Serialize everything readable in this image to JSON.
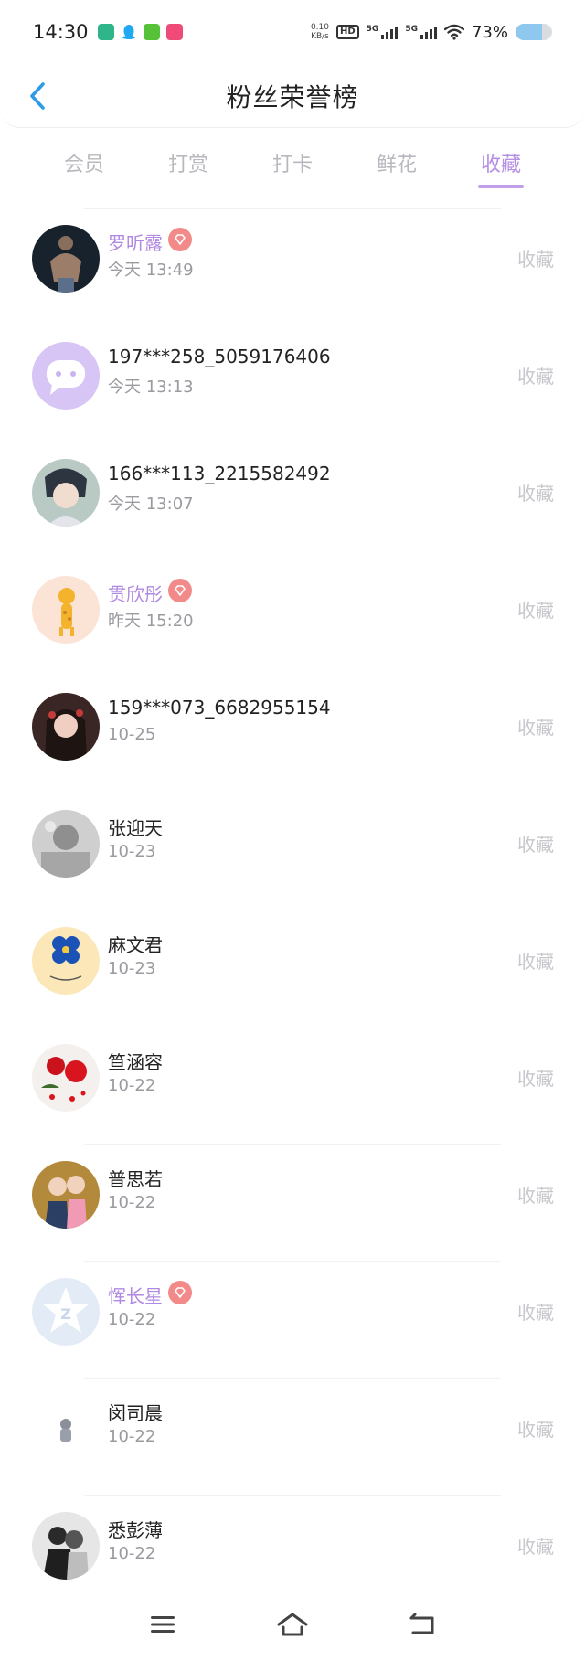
{
  "status_bar": {
    "time": "14:30",
    "net_speed_value": "0.10",
    "net_speed_unit": "KB/s",
    "hd_label": "HD",
    "sim1_label": "5G",
    "sim2_label": "5G",
    "battery_percent_text": "73%",
    "battery_level": 0.73,
    "app_icons": [
      "aggregator-app-icon",
      "qq-icon",
      "wechat-icon",
      "shop-app-icon"
    ]
  },
  "header": {
    "title": "粉丝荣誉榜",
    "back_icon": "chevron-left-icon"
  },
  "tabs": [
    {
      "label": "会员",
      "active": false
    },
    {
      "label": "打赏",
      "active": false
    },
    {
      "label": "打卡",
      "active": false
    },
    {
      "label": "鲜花",
      "active": false
    },
    {
      "label": "收藏",
      "active": true
    }
  ],
  "colors": {
    "accent": "#b590e6",
    "vip_name": "#b08ae2",
    "vip_badge": "#f28a8a",
    "back_arrow": "#2f9be8"
  },
  "fans": [
    {
      "name": "罗听露",
      "time": "今天 13:49",
      "vip": true,
      "action": "收藏",
      "avatar": "muscular-man-photo"
    },
    {
      "name": "197***258_5059176406",
      "time": "今天 13:13",
      "vip": false,
      "action": "收藏",
      "avatar": "default-chat-avatar"
    },
    {
      "name": "166***113_2215582492",
      "time": "今天 13:07",
      "vip": false,
      "action": "收藏",
      "avatar": "anime-boy-photo"
    },
    {
      "name": "贯欣彤",
      "time": "昨天 15:20",
      "vip": true,
      "action": "收藏",
      "avatar": "cartoon-deer-photo"
    },
    {
      "name": "159***073_6682955154",
      "time": "10-25",
      "vip": false,
      "action": "收藏",
      "avatar": "girl-portrait-photo"
    },
    {
      "name": "张迎天",
      "time": "10-23",
      "vip": false,
      "action": "收藏",
      "avatar": "grayscale-photo"
    },
    {
      "name": "麻文君",
      "time": "10-23",
      "vip": false,
      "action": "收藏",
      "avatar": "blue-flower-drawing"
    },
    {
      "name": "笪涵容",
      "time": "10-22",
      "vip": false,
      "action": "收藏",
      "avatar": "red-roses-photo"
    },
    {
      "name": "普思若",
      "time": "10-22",
      "vip": false,
      "action": "收藏",
      "avatar": "couple-photo"
    },
    {
      "name": "恽长星",
      "time": "10-22",
      "vip": true,
      "action": "收藏",
      "avatar": "default-star-avatar"
    },
    {
      "name": "闵司晨",
      "time": "10-22",
      "vip": false,
      "action": "收藏",
      "avatar": "small-figure-photo"
    },
    {
      "name": "悉彭薄",
      "time": "10-22",
      "vip": false,
      "action": "收藏",
      "avatar": "bw-couple-photo"
    }
  ],
  "nav_bar": {
    "menu_icon": "menu-icon",
    "home_icon": "home-icon",
    "back_icon": "back-icon"
  }
}
